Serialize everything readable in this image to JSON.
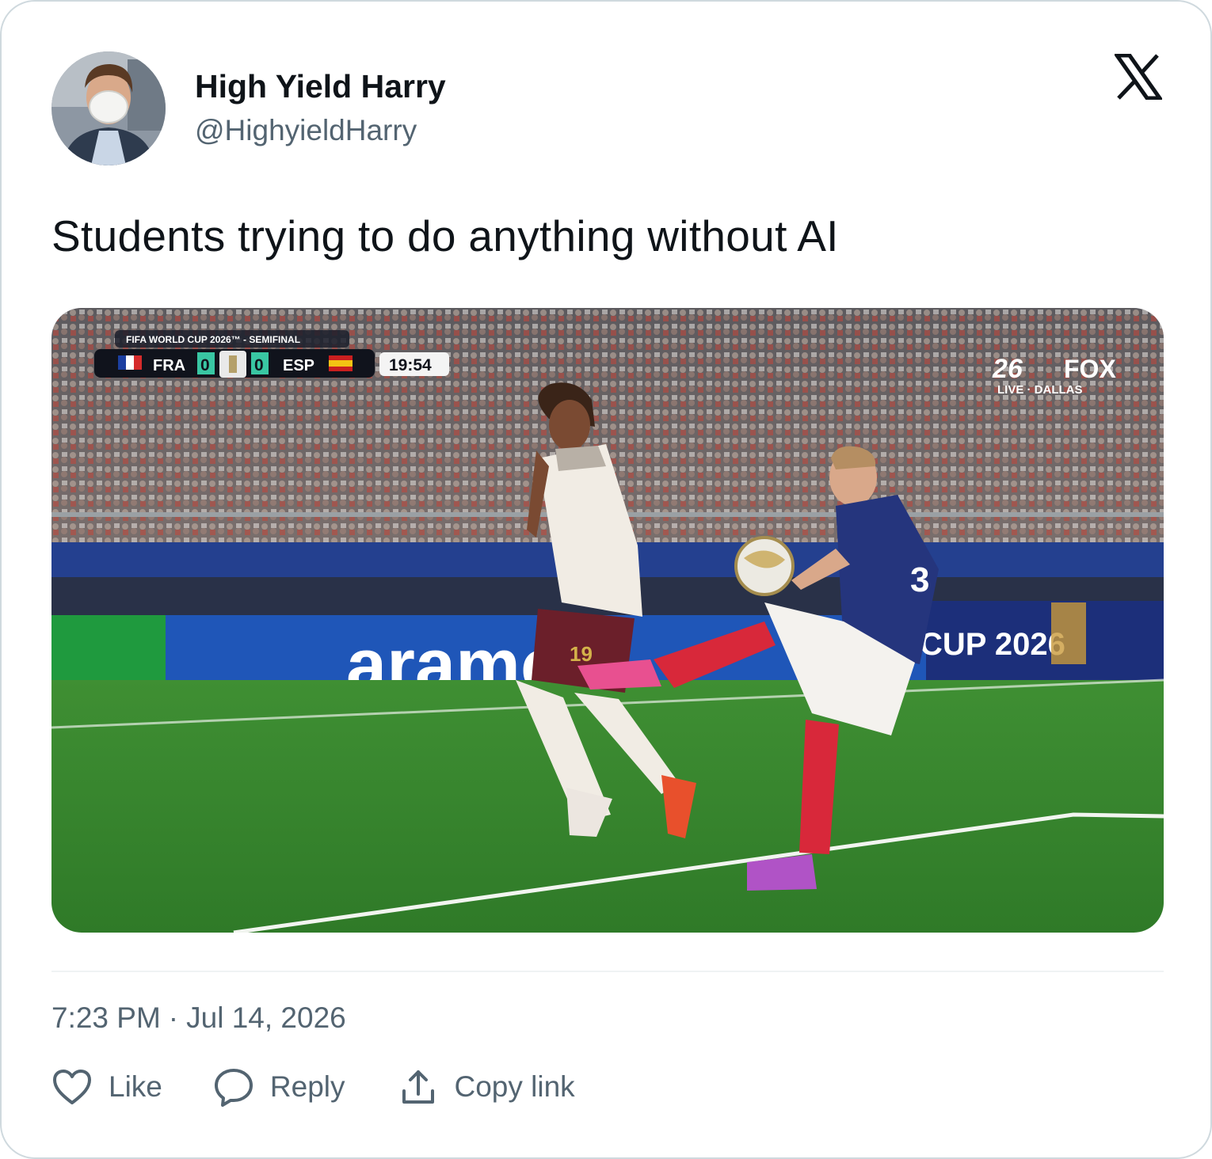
{
  "author": {
    "display_name": "High Yield Harry",
    "handle": "@HighyieldHarry"
  },
  "tweet": {
    "text": "Students trying to do anything without AI"
  },
  "media": {
    "broadcast": {
      "competition": "FIFA WORLD CUP 2026™ - SEMIFINAL",
      "home_team": "FRA",
      "home_score": "0",
      "away_score": "0",
      "away_team": "ESP",
      "clock": "19:54",
      "network_tag": "26",
      "network": "FOX",
      "feed": "LIVE · DALLAS"
    },
    "board_ads": [
      "aramc",
      "CUP 2026"
    ],
    "shirt_number_left": "19",
    "shirt_number_right": "3"
  },
  "meta": {
    "time": "7:23 PM",
    "separator": "·",
    "date": "Jul 14, 2026"
  },
  "actions": {
    "like": "Like",
    "reply": "Reply",
    "copy_link": "Copy link"
  },
  "icons": {
    "brand": "x-logo-icon",
    "like": "heart-icon",
    "reply": "speech-bubble-icon",
    "copy": "share-upload-icon"
  },
  "colors": {
    "text_primary": "#0f1419",
    "text_secondary": "#536471",
    "border": "#cfd9de",
    "pitch": "#3d8a34",
    "board_blue": "#1f56b8"
  }
}
